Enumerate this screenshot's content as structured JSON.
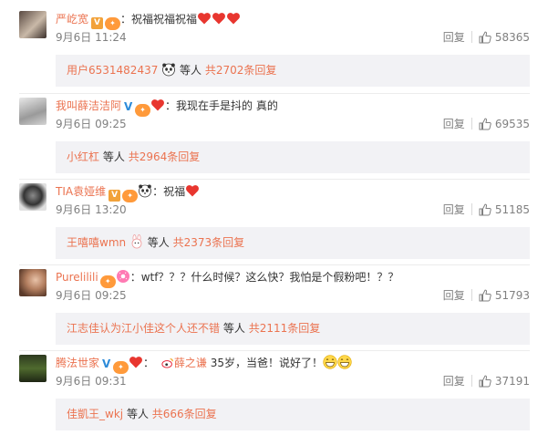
{
  "comments": [
    {
      "username": "严屹宽",
      "content": "：祝福祝福祝福",
      "time": "9月6日 11:24",
      "reply_label": "回复",
      "likes": "58365",
      "reply_preview": {
        "user": "用户6531482437",
        "text": "等人",
        "count": "共2702条回复"
      }
    },
    {
      "username": "我叫薛洁洁阿",
      "content": "：我现在手是抖的 真的",
      "time": "9月6日 09:25",
      "reply_label": "回复",
      "likes": "69535",
      "reply_preview": {
        "user": "小红杠",
        "text": "等人",
        "count": "共2964条回复"
      }
    },
    {
      "username": "TIA袁娅维",
      "content": "：祝福",
      "time": "9月6日 13:20",
      "reply_label": "回复",
      "likes": "51185",
      "reply_preview": {
        "user": "王嘻嘻wmn",
        "text": "等人",
        "count": "共2373条回复"
      }
    },
    {
      "username": "Purelilili",
      "content": "：wtf？？？什么时候？这么快？我怕是个假粉吧！？？",
      "time": "9月6日 09:25",
      "reply_label": "回复",
      "likes": "51793",
      "reply_preview": {
        "user": "江志佳认为江小佳这个人还不错",
        "text": "等人",
        "count": "共2111条回复"
      }
    },
    {
      "username": "腾法世家",
      "content": "：",
      "mention": "薛之谦",
      "content_after": " 35岁，当爸！说好了！",
      "time": "9月6日 09:31",
      "reply_label": "回复",
      "likes": "37191",
      "reply_preview": {
        "user": "佳凱王_wkj",
        "text": "等人",
        "count": "共666条回复"
      }
    }
  ],
  "colors": {
    "username": "#eb7350",
    "meta": "#808080",
    "reply_bg": "#f2f2f5",
    "heart": "#e8362f"
  },
  "icons": [
    "avatar",
    "verified-v-icon",
    "fan-badge-icon",
    "heart-emoji-icon",
    "panda-emoji-icon",
    "thumbs-up-icon",
    "grin-emoji-icon"
  ]
}
